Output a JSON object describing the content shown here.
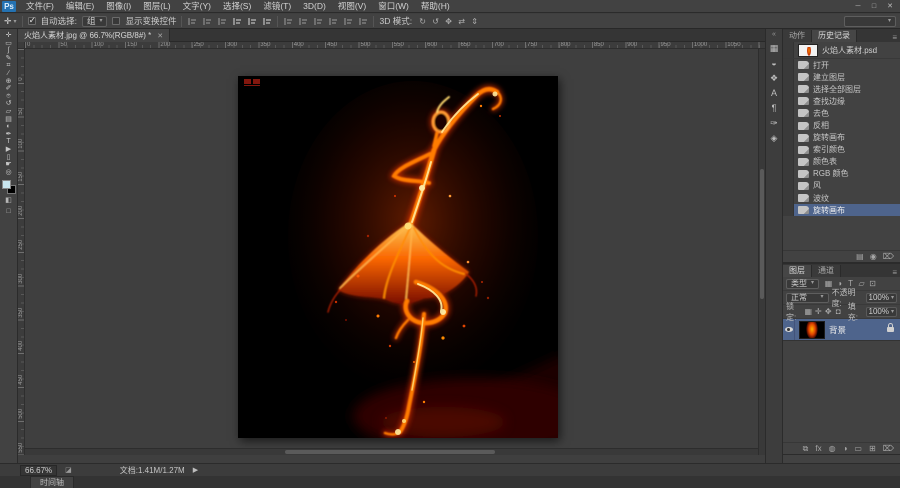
{
  "app": {
    "logo_text": "Ps",
    "window_controls": [
      {
        "name": "minimize-button",
        "glyph": "─"
      },
      {
        "name": "restore-button",
        "glyph": "□"
      },
      {
        "name": "close-button",
        "glyph": "✕"
      }
    ]
  },
  "menu_bar": {
    "items": [
      "文件(F)",
      "编辑(E)",
      "图像(I)",
      "图层(L)",
      "文字(Y)",
      "选择(S)",
      "滤镜(T)",
      "3D(D)",
      "视图(V)",
      "窗口(W)",
      "帮助(H)"
    ]
  },
  "options_bar": {
    "tool_glyph": "✛",
    "auto_select_label": "自动选择:",
    "auto_select_value": "组",
    "show_transform_label": "显示变换控件",
    "mode_label": "3D 模式:",
    "mode_icons": [
      {
        "name": "3d-rotate-icon",
        "glyph": "↻"
      },
      {
        "name": "3d-roll-icon",
        "glyph": "↺"
      },
      {
        "name": "3d-drag-icon",
        "glyph": "✥"
      },
      {
        "name": "3d-slide-icon",
        "glyph": "⇄"
      },
      {
        "name": "3d-scale-icon",
        "glyph": "⇕"
      }
    ]
  },
  "document": {
    "tab_title": "火焰人素材.jpg @ 66.7%(RGB/8#) *"
  },
  "rulers": {
    "horizontal": [
      "0",
      "50",
      "100",
      "150",
      "200",
      "250",
      "300",
      "350",
      "400",
      "450",
      "500",
      "550",
      "600",
      "650",
      "700",
      "750",
      "800",
      "850",
      "900",
      "950",
      "1000",
      "1050"
    ],
    "vertical": [
      "0",
      "50",
      "100",
      "150",
      "200",
      "250",
      "300",
      "350",
      "400",
      "450",
      "500",
      "550"
    ]
  },
  "toolbar": {
    "tools": [
      {
        "name": "move-tool",
        "glyph": "✛"
      },
      {
        "name": "marquee-tool",
        "glyph": "▭"
      },
      {
        "name": "lasso-tool",
        "glyph": "ʃ"
      },
      {
        "name": "quick-selection-tool",
        "glyph": "✎"
      },
      {
        "name": "crop-tool",
        "glyph": "⌗"
      },
      {
        "name": "eyedropper-tool",
        "glyph": "∕"
      },
      {
        "name": "healing-brush-tool",
        "glyph": "⊕"
      },
      {
        "name": "brush-tool",
        "glyph": "✐"
      },
      {
        "name": "clone-stamp-tool",
        "glyph": "⌾"
      },
      {
        "name": "history-brush-tool",
        "glyph": "↺"
      },
      {
        "name": "eraser-tool",
        "glyph": "▱"
      },
      {
        "name": "gradient-tool",
        "glyph": "▤"
      },
      {
        "name": "dodge-tool",
        "glyph": "◐"
      },
      {
        "name": "pen-tool",
        "glyph": "✒"
      },
      {
        "name": "type-tool",
        "glyph": "T"
      },
      {
        "name": "path-selection-tool",
        "glyph": "▶"
      },
      {
        "name": "rectangle-tool",
        "glyph": "▯"
      },
      {
        "name": "hand-tool",
        "glyph": "☛"
      },
      {
        "name": "zoom-tool",
        "glyph": "◎"
      }
    ],
    "foreground_color": "#c9e6ef",
    "background_color": "#000000",
    "extras": [
      {
        "name": "quick-mask-button",
        "glyph": "◧"
      },
      {
        "name": "screen-mode-button",
        "glyph": "□"
      }
    ]
  },
  "dock": {
    "chevrons": "«",
    "icons": [
      {
        "name": "swatches-icon",
        "glyph": "▦"
      },
      {
        "name": "adjustments-icon",
        "glyph": "◒"
      },
      {
        "name": "styles-icon",
        "glyph": "❖"
      },
      {
        "name": "character-icon",
        "glyph": "A"
      },
      {
        "name": "paragraph-icon",
        "glyph": "¶"
      },
      {
        "name": "tool-presets-icon",
        "glyph": "✑"
      },
      {
        "name": "info-icon",
        "glyph": "◈"
      }
    ]
  },
  "history_panel": {
    "tabs": [
      "动作",
      "历史记录"
    ],
    "snapshot_name": "火焰人素材.psd",
    "states": [
      "打开",
      "建立图层",
      "选择全部图层",
      "查找边缘",
      "去色",
      "反相",
      "旋转画布",
      "索引颜色",
      "颜色表",
      "RGB 颜色",
      "风",
      "波纹",
      "旋转画布"
    ],
    "selected_index": 12,
    "buttons": [
      {
        "name": "new-doc-from-state-button",
        "glyph": "▤"
      },
      {
        "name": "new-snapshot-button",
        "glyph": "◉"
      },
      {
        "name": "delete-state-button",
        "glyph": "⌦"
      }
    ]
  },
  "layers_panel": {
    "tabs": [
      "图层",
      "通道"
    ],
    "filter_label": "类型",
    "filter_icons": [
      {
        "name": "filter-pixel-layers-icon",
        "glyph": "▦"
      },
      {
        "name": "filter-adjustment-layers-icon",
        "glyph": "◑"
      },
      {
        "name": "filter-type-layers-icon",
        "glyph": "T"
      },
      {
        "name": "filter-shape-layers-icon",
        "glyph": "▱"
      },
      {
        "name": "filter-smart-objects-icon",
        "glyph": "⊡"
      }
    ],
    "blend_mode": "正常",
    "opacity_label": "不透明度:",
    "opacity_value": "100%",
    "lock_label": "锁定:",
    "lock_icons": [
      {
        "name": "lock-transparency-icon",
        "glyph": "▦"
      },
      {
        "name": "lock-pixels-icon",
        "glyph": "✛"
      },
      {
        "name": "lock-position-icon",
        "glyph": "✥"
      },
      {
        "name": "lock-all-icon",
        "glyph": "◘"
      }
    ],
    "fill_label": "填充:",
    "fill_value": "100%",
    "layer_name": "背景",
    "buttons": [
      {
        "name": "link-layers-button",
        "glyph": "⧉"
      },
      {
        "name": "layer-style-button",
        "glyph": "fx"
      },
      {
        "name": "add-mask-button",
        "glyph": "◍"
      },
      {
        "name": "adjustment-layer-button",
        "glyph": "◑"
      },
      {
        "name": "layer-group-button",
        "glyph": "▭"
      },
      {
        "name": "new-layer-button",
        "glyph": "⊞"
      },
      {
        "name": "delete-layer-button",
        "glyph": "⌦"
      }
    ]
  },
  "status_bar": {
    "zoom": "66.67%",
    "scrubby_icon_glyph": "◪",
    "doc_label": "文档:1.41M/1.27M",
    "arrow_glyph": "▶"
  },
  "bottom_strip": {
    "timeline_tab": "时间轴"
  },
  "icons": {
    "caret": "▾",
    "tab_close": "✕",
    "panel_menu": "≡"
  },
  "colors": {
    "selection": "#4e648c",
    "fire_accent": "#ff7b00",
    "ps_logo_blue": "#2472b2"
  }
}
